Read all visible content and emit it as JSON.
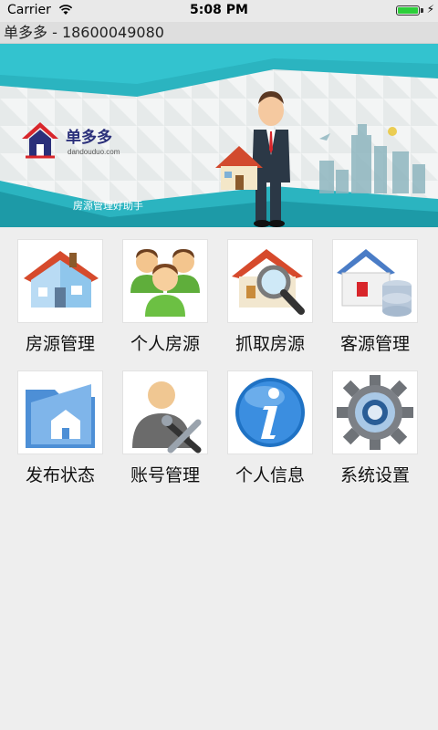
{
  "status_bar": {
    "carrier": "Carrier",
    "time": "5:08 PM",
    "battery_level": 1.0
  },
  "title_bar": {
    "title": "单多多 - 18600049080"
  },
  "banner": {
    "logo_name": "单多多",
    "logo_domain": "dandouduo.com",
    "slogan": "房源管理好助手",
    "colors": {
      "teal": "#2bb4c0",
      "dark_teal": "#1d8f9c",
      "logo_red": "#d8262b",
      "logo_navy": "#2a2f7a"
    }
  },
  "menu": {
    "items": [
      {
        "label": "房源管理",
        "icon": "house-icon"
      },
      {
        "label": "个人房源",
        "icon": "people-group-icon"
      },
      {
        "label": "抓取房源",
        "icon": "house-search-icon"
      },
      {
        "label": "客源管理",
        "icon": "house-database-icon"
      },
      {
        "label": "发布状态",
        "icon": "folder-house-icon"
      },
      {
        "label": "账号管理",
        "icon": "user-tools-icon"
      },
      {
        "label": "个人信息",
        "icon": "info-icon"
      },
      {
        "label": "系统设置",
        "icon": "gear-icon"
      }
    ]
  }
}
